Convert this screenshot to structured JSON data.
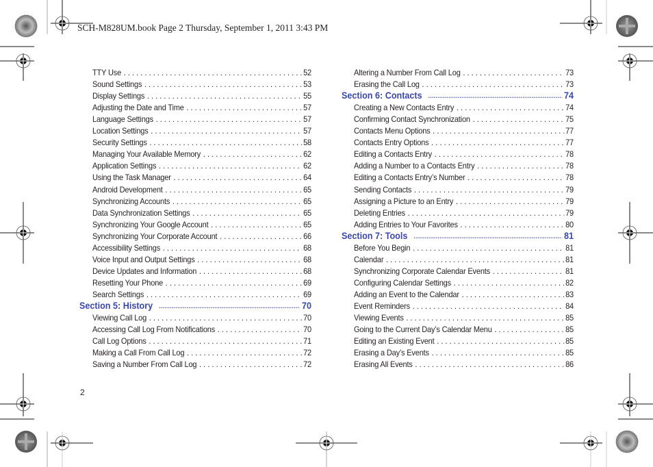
{
  "header": {
    "text": "SCH-M828UM.book  Page 2  Thursday, September 1, 2011  3:43 PM"
  },
  "colors": {
    "section_heading": "#3a48a8",
    "body_text": "#231f20"
  },
  "left_column": {
    "entries": [
      {
        "title": "TTY Use",
        "page": "52"
      },
      {
        "title": "Sound Settings",
        "page": "53"
      },
      {
        "title": "Display Settings",
        "page": "55"
      },
      {
        "title": "Adjusting the Date and Time",
        "page": "57"
      },
      {
        "title": "Language Settings",
        "page": "57"
      },
      {
        "title": "Location Settings",
        "page": "57"
      },
      {
        "title": "Security Settings",
        "page": "58"
      },
      {
        "title": "Managing Your Available Memory",
        "page": "62"
      },
      {
        "title": "Application Settings",
        "page": "62"
      },
      {
        "title": "Using the Task Manager",
        "page": "64"
      },
      {
        "title": "Android Development",
        "page": "65"
      },
      {
        "title": "Synchronizing Accounts",
        "page": "65"
      },
      {
        "title": "Data Synchronization Settings",
        "page": "65"
      },
      {
        "title": "Synchronizing Your Google Account",
        "page": "65"
      },
      {
        "title": "Synchronizing Your Corporate Account",
        "page": "66"
      },
      {
        "title": "Accessibility Settings",
        "page": "68"
      },
      {
        "title": "Voice Input and Output Settings",
        "page": "68"
      },
      {
        "title": "Device Updates and Information",
        "page": "68"
      },
      {
        "title": "Resetting Your Phone",
        "page": "69"
      },
      {
        "title": "Search Settings",
        "page": "69"
      }
    ],
    "section5": {
      "title": "Section 5:  History",
      "page": "70",
      "entries": [
        {
          "title": "Viewing Call Log",
          "page": "70"
        },
        {
          "title": "Accessing Call Log From Notifications",
          "page": "70"
        },
        {
          "title": "Call Log Options",
          "page": "71"
        },
        {
          "title": "Making a Call From Call Log",
          "page": "72"
        },
        {
          "title": "Saving a Number From Call Log",
          "page": "72"
        }
      ]
    }
  },
  "right_column": {
    "entries": [
      {
        "title": "Altering a Number From Call Log",
        "page": "73"
      },
      {
        "title": "Erasing the Call Log",
        "page": "73"
      }
    ],
    "section6": {
      "title": "Section 6:  Contacts",
      "page": "74",
      "entries": [
        {
          "title": "Creating a New Contacts Entry",
          "page": "74"
        },
        {
          "title": "Confirming Contact Synchronization",
          "page": "75"
        },
        {
          "title": "Contacts Menu Options",
          "page": "77"
        },
        {
          "title": "Contacts Entry Options",
          "page": "77"
        },
        {
          "title": "Editing a Contacts Entry",
          "page": "78"
        },
        {
          "title": "Adding a Number to a Contacts Entry",
          "page": "78"
        },
        {
          "title": "Editing a Contacts Entry’s Number",
          "page": "78"
        },
        {
          "title": "Sending Contacts",
          "page": "79"
        },
        {
          "title": "Assigning a Picture to an Entry",
          "page": "79"
        },
        {
          "title": "Deleting Entries",
          "page": "79"
        },
        {
          "title": "Adding Entries to Your Favorites",
          "page": "80"
        }
      ]
    },
    "section7": {
      "title": "Section 7:  Tools",
      "page": "81",
      "entries": [
        {
          "title": "Before You Begin",
          "page": "81"
        },
        {
          "title": "Calendar",
          "page": "81"
        },
        {
          "title": "Synchronizing Corporate Calendar Events",
          "page": "81"
        },
        {
          "title": "Configuring Calendar Settings",
          "page": "82"
        },
        {
          "title": "Adding an Event to the Calendar",
          "page": "83"
        },
        {
          "title": "Event Reminders",
          "page": "84"
        },
        {
          "title": "Viewing Events",
          "page": "85"
        },
        {
          "title": "Going to the Current Day’s Calendar Menu",
          "page": "85"
        },
        {
          "title": "Editing an Existing Event",
          "page": "85"
        },
        {
          "title": "Erasing a Day’s Events",
          "page": "85"
        },
        {
          "title": "Erasing All Events",
          "page": "86"
        }
      ]
    }
  },
  "footer": {
    "page_number": "2"
  }
}
